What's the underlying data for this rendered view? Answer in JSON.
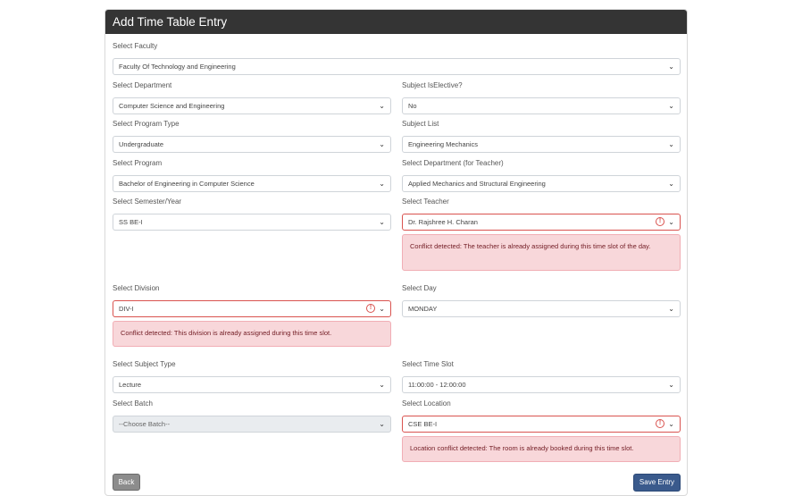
{
  "header": {
    "title": "Add Time Table Entry"
  },
  "fields": {
    "faculty": {
      "label": "Select Faculty",
      "value": "Faculty Of Technology and Engineering"
    },
    "department": {
      "label": "Select Department",
      "value": "Computer Science and Engineering"
    },
    "is_elective": {
      "label": "Subject IsElective?",
      "value": "No"
    },
    "program_type": {
      "label": "Select Program Type",
      "value": "Undergraduate"
    },
    "subject_list": {
      "label": "Subject List",
      "value": "Engineering Mechanics"
    },
    "program": {
      "label": "Select Program",
      "value": "Bachelor of Engineering in Computer Science"
    },
    "teacher_department": {
      "label": "Select Department (for Teacher)",
      "value": "Applied Mechanics and Structural Engineering"
    },
    "semester": {
      "label": "Select Semester/Year",
      "value": "SS BE-I"
    },
    "teacher": {
      "label": "Select Teacher",
      "value": "Dr. Rajshree H. Charan",
      "error": "Conflict detected: The teacher is already assigned during this time slot of the day."
    },
    "division": {
      "label": "Select Division",
      "value": "DIV-I",
      "error": "Conflict detected: This division is already assigned during this time slot."
    },
    "day": {
      "label": "Select Day",
      "value": "MONDAY"
    },
    "subject_type": {
      "label": "Select Subject Type",
      "value": "Lecture"
    },
    "time_slot": {
      "label": "Select Time Slot",
      "value": "11:00:00 - 12:00:00"
    },
    "batch": {
      "label": "Select Batch",
      "value": "--Choose Batch--"
    },
    "location": {
      "label": "Select Location",
      "value": "CSE BE-I",
      "error": "Location conflict detected: The room is already booked during this time slot."
    }
  },
  "buttons": {
    "back": "Back",
    "save": "Save Entry"
  },
  "icons": {
    "dropdown": "chevron-down-icon",
    "error": "exclamation-circle-icon"
  },
  "colors": {
    "header_bg": "#343434",
    "alert_bg": "#f8d7da",
    "invalid_border": "#d9534f",
    "save_button": "#3a5a8c",
    "back_button": "#8c8c8c"
  }
}
